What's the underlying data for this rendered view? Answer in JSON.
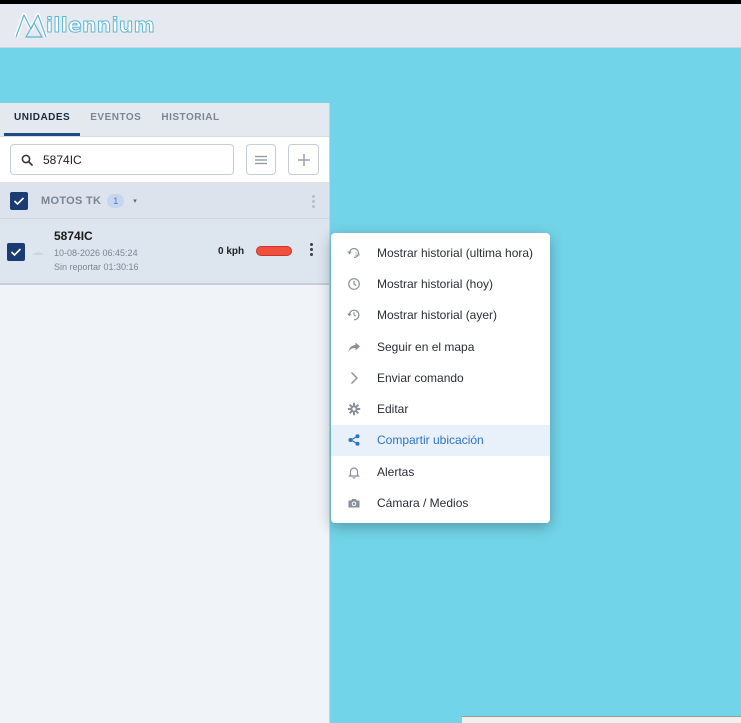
{
  "app": {
    "logo_text": "illennium",
    "logo_letter": "M"
  },
  "tabs": [
    {
      "label": "UNIDADES",
      "active": true
    },
    {
      "label": "EVENTOS",
      "active": false
    },
    {
      "label": "HISTORIAL",
      "active": false
    }
  ],
  "search": {
    "value": "5874IC",
    "placeholder": ""
  },
  "group": {
    "name": "MOTOS TK",
    "count": "1",
    "caret": "▾"
  },
  "unit": {
    "name": "5874IC",
    "date": "10-08-2026 06:45:24",
    "status": "Sin reportar 01:30:16",
    "speed": "0 kph",
    "status_color": "#f0503c"
  },
  "context_menu": {
    "items": [
      {
        "label": "Mostrar historial (ultima hora)",
        "icon": "history-hour-icon"
      },
      {
        "label": "Mostrar historial (hoy)",
        "icon": "clock-icon"
      },
      {
        "label": "Mostrar historial (ayer)",
        "icon": "history-back-icon"
      },
      {
        "label": "Seguir en el mapa",
        "icon": "share-arrow-icon"
      },
      {
        "label": "Enviar comando",
        "icon": "chevron-right-icon"
      },
      {
        "label": "Editar",
        "icon": "gear-icon"
      },
      {
        "label": "Compartir ubicación",
        "icon": "share-icon",
        "active": true
      },
      {
        "label": "Alertas",
        "icon": "bell-icon"
      },
      {
        "label": "Cámara / Medios",
        "icon": "camera-icon"
      }
    ]
  },
  "colors": {
    "map": "#72d4e8",
    "accent": "#1b3c72",
    "menu_active": "#2e73c8"
  }
}
